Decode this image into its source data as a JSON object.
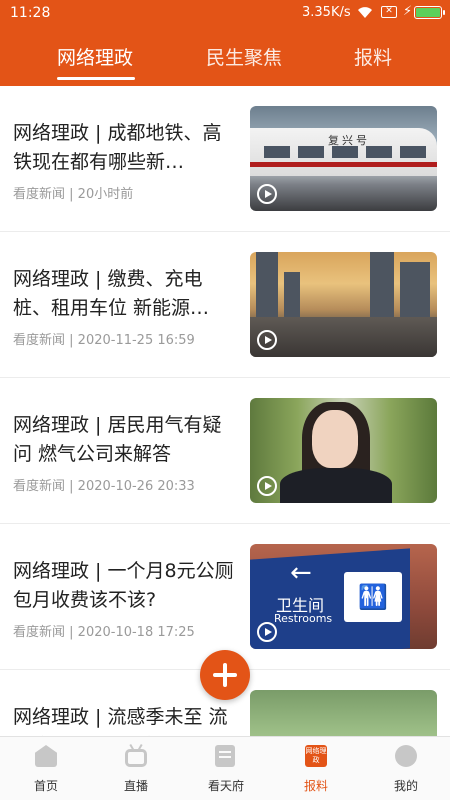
{
  "status_bar": {
    "time": "11:28",
    "network_speed": "3.35K/s",
    "battery_color": "#5bd05b"
  },
  "theme": {
    "accent": "#e35417"
  },
  "tabs": [
    {
      "label": "网络理政",
      "active": true
    },
    {
      "label": "民生聚焦",
      "active": false
    },
    {
      "label": "报料",
      "active": false
    }
  ],
  "news": [
    {
      "title": "网络理政 | 成都地铁、高铁现在都有哪些新…",
      "source": "看度新闻",
      "time": "20小时前",
      "has_video": true
    },
    {
      "title": "网络理政 | 缴费、充电桩、租用车位 新能源…",
      "source": "看度新闻",
      "time": "2020-11-25 16:59",
      "has_video": true
    },
    {
      "title": "网络理政 | 居民用气有疑问 燃气公司来解答",
      "source": "看度新闻",
      "time": "2020-10-26 20:33",
      "has_video": true
    },
    {
      "title": "网络理政 | 一个月8元公厕包月收费该不该?",
      "source": "看度新闻",
      "time": "2020-10-18 17:25",
      "has_video": true
    },
    {
      "title": "网络理政 | 流感季未至 流感疫苗已出现“抢苗”",
      "source": "",
      "time": "",
      "has_video": true
    }
  ],
  "thumb_text": {
    "train_sign": "复兴号",
    "toilet_cn": "卫生间",
    "toilet_en": "Restrooms"
  },
  "bottom_nav": [
    {
      "label": "首页",
      "icon": "home-icon"
    },
    {
      "label": "直播",
      "icon": "tv-icon"
    },
    {
      "label": "看天府",
      "icon": "document-icon"
    },
    {
      "label": "报料",
      "icon": "report-icon",
      "active": true,
      "icon_text": "网络理政"
    },
    {
      "label": "我的",
      "icon": "user-icon"
    }
  ]
}
